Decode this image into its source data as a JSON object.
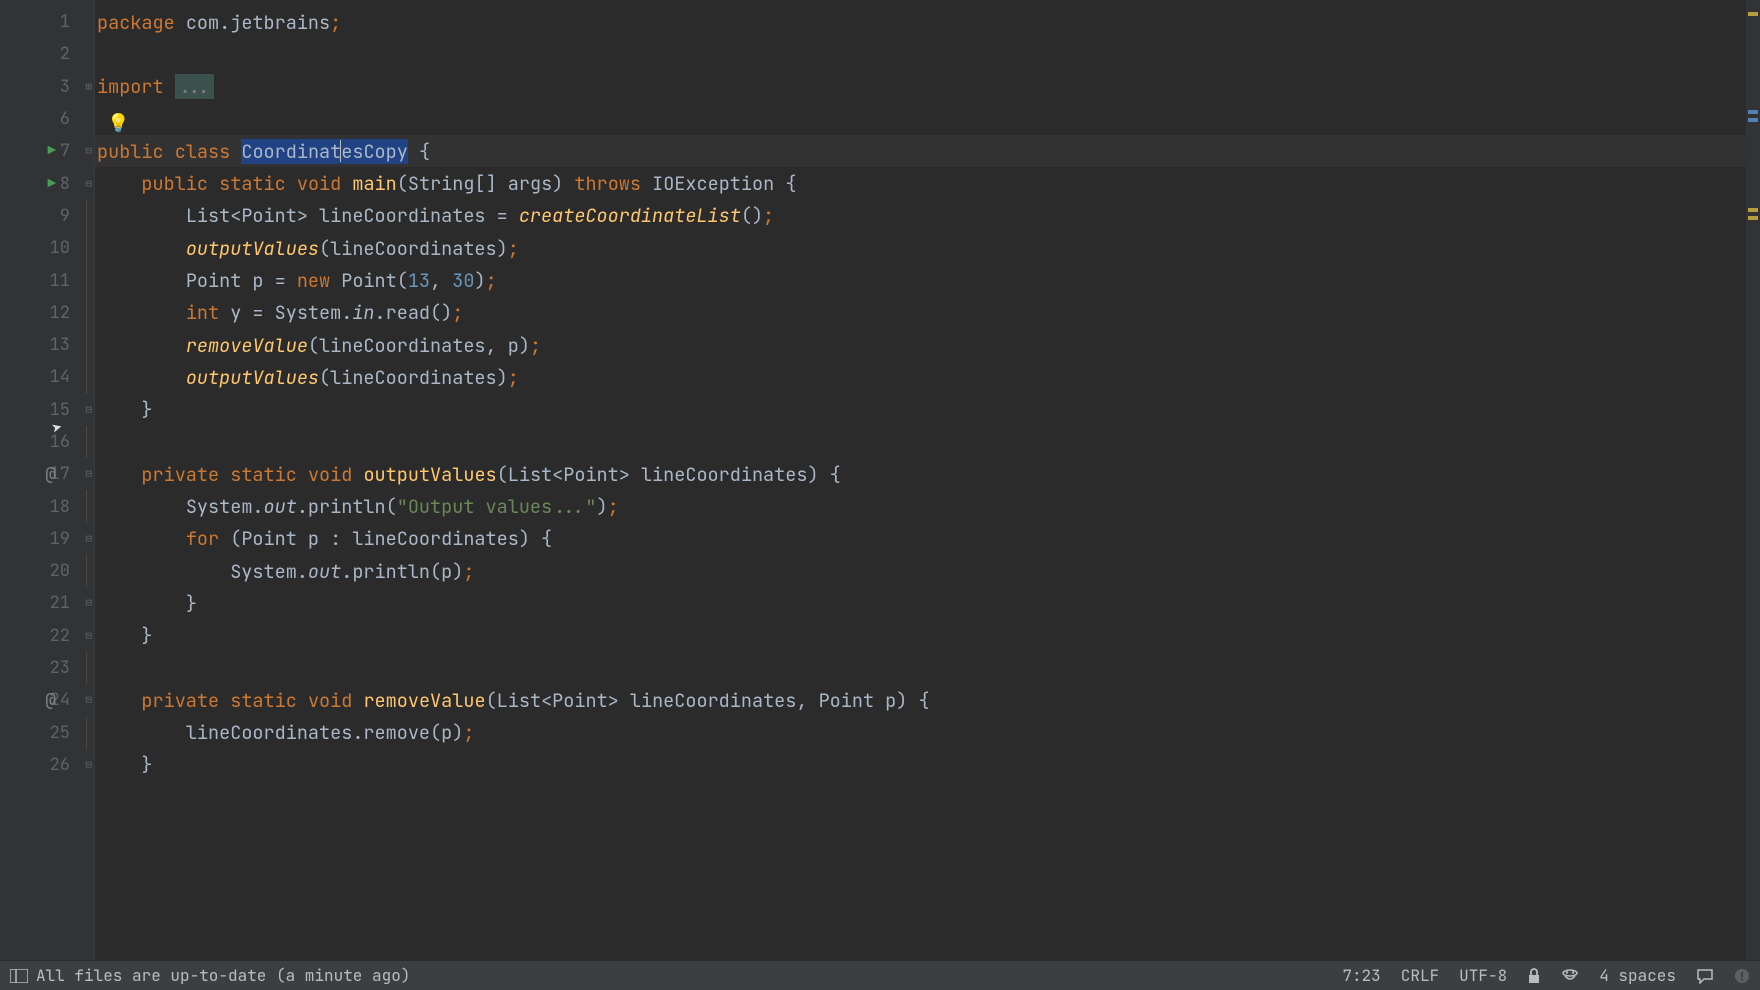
{
  "gutter": {
    "lines": [
      "1",
      "2",
      "3",
      "6",
      "7",
      "8",
      "9",
      "10",
      "11",
      "12",
      "13",
      "14",
      "15",
      "16",
      "17",
      "18",
      "19",
      "20",
      "21",
      "22",
      "23",
      "24",
      "25",
      "26"
    ],
    "run_markers": {
      "7": true,
      "8": true
    },
    "at_markers": {
      "17": true,
      "24": true
    }
  },
  "code": {
    "l1": {
      "kw": "package",
      "pkg": "com.jetbrains"
    },
    "l3": {
      "kw": "import",
      "folded": "..."
    },
    "l7": {
      "kw1": "public",
      "kw2": "class",
      "name_a": "Coordinat",
      "name_b": "esCopy"
    },
    "l8": {
      "kw1": "public",
      "kw2": "static",
      "kw3": "void",
      "mth": "main",
      "args": "(String[] args)",
      "kw4": "throws",
      "exc": "IOException"
    },
    "l9": {
      "type": "List<Point> lineCoordinates = ",
      "mth": "createCoordinateList",
      "end": "()"
    },
    "l10": {
      "mth": "outputValues",
      "args": "(lineCoordinates)"
    },
    "l11": {
      "pre": "Point p = ",
      "kw": "new",
      "cls": " Point(",
      "n1": "13",
      "c": ", ",
      "n2": "30",
      "end": ")"
    },
    "l12": {
      "kw": "int",
      "var": " y = System.",
      "in": "in",
      "rest": ".read()"
    },
    "l13": {
      "mth": "removeValue",
      "args": "(lineCoordinates, p)"
    },
    "l14": {
      "mth": "outputValues",
      "args": "(lineCoordinates)"
    },
    "l15": {
      "brace": "}"
    },
    "l17": {
      "kw1": "private",
      "kw2": "static",
      "kw3": "void",
      "mth": "outputValues",
      "args": "(List<Point> lineCoordinates) {"
    },
    "l18": {
      "pre": "System.",
      "out": "out",
      "mid": ".println(",
      "str": "\"Output values...\"",
      "end": ")"
    },
    "l19": {
      "kw": "for",
      "rest": " (Point p : lineCoordinates) {"
    },
    "l20": {
      "pre": "System.",
      "out": "out",
      "rest": ".println(p)"
    },
    "l21": {
      "brace": "}"
    },
    "l22": {
      "brace": "}"
    },
    "l24": {
      "kw1": "private",
      "kw2": "static",
      "kw3": "void",
      "mth": "removeValue",
      "args": "(List<Point> lineCoordinates, Point p) {"
    },
    "l25": {
      "txt": "lineCoordinates.remove(p)"
    },
    "l26": {
      "brace": "}"
    }
  },
  "status": {
    "message": "All files are up-to-date (a minute ago)",
    "position": "7:23",
    "line_sep": "CRLF",
    "encoding": "UTF-8",
    "indent": "4 spaces"
  }
}
